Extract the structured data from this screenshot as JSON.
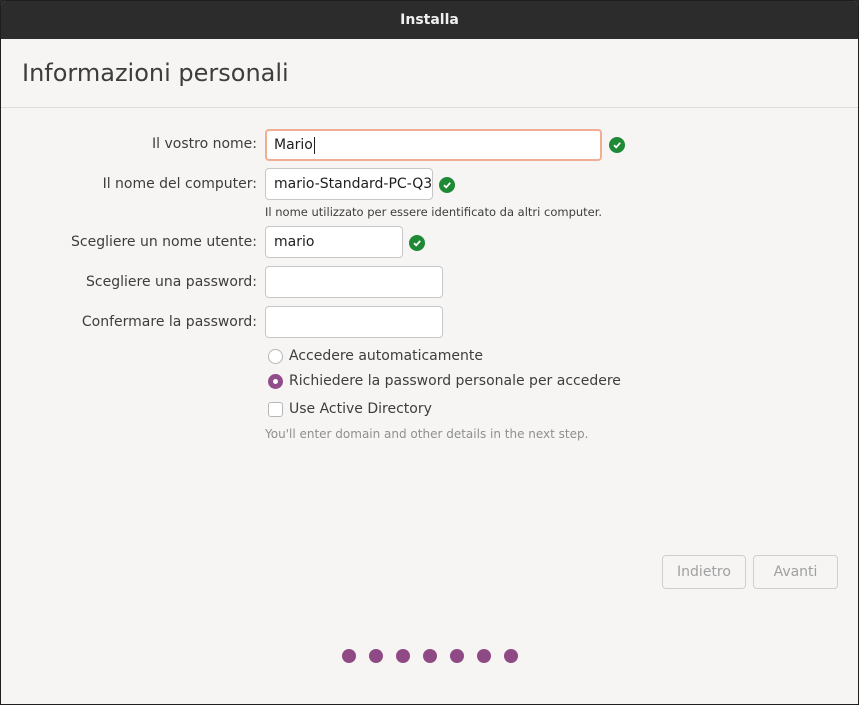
{
  "window": {
    "title": "Installa"
  },
  "page": {
    "title": "Informazioni personali"
  },
  "form": {
    "name_label": "Il vostro nome:",
    "name_value": "Mario",
    "computer_label": "Il nome del computer:",
    "computer_value": "mario-Standard-PC-Q3",
    "computer_hint": "Il nome utilizzato per essere identificato da altri computer.",
    "username_label": "Scegliere un nome utente:",
    "username_value": "mario",
    "password_label": "Scegliere una password:",
    "password_value": "",
    "confirm_label": "Confermare la password:",
    "confirm_value": ""
  },
  "options": {
    "auto_login_label": "Accedere automaticamente",
    "auto_login_selected": false,
    "require_password_label": "Richiedere la password personale per accedere",
    "require_password_selected": true,
    "active_directory_label": "Use Active Directory",
    "active_directory_checked": false,
    "active_directory_hint": "You'll enter domain and other details in the next step."
  },
  "buttons": {
    "back": "Indietro",
    "next": "Avanti"
  },
  "icons": {
    "valid": "check-circle-icon"
  },
  "progress": {
    "steps": 7
  },
  "colors": {
    "accent": "#924d8b",
    "valid": "#1f8a36",
    "focus": "#f3ad92"
  }
}
